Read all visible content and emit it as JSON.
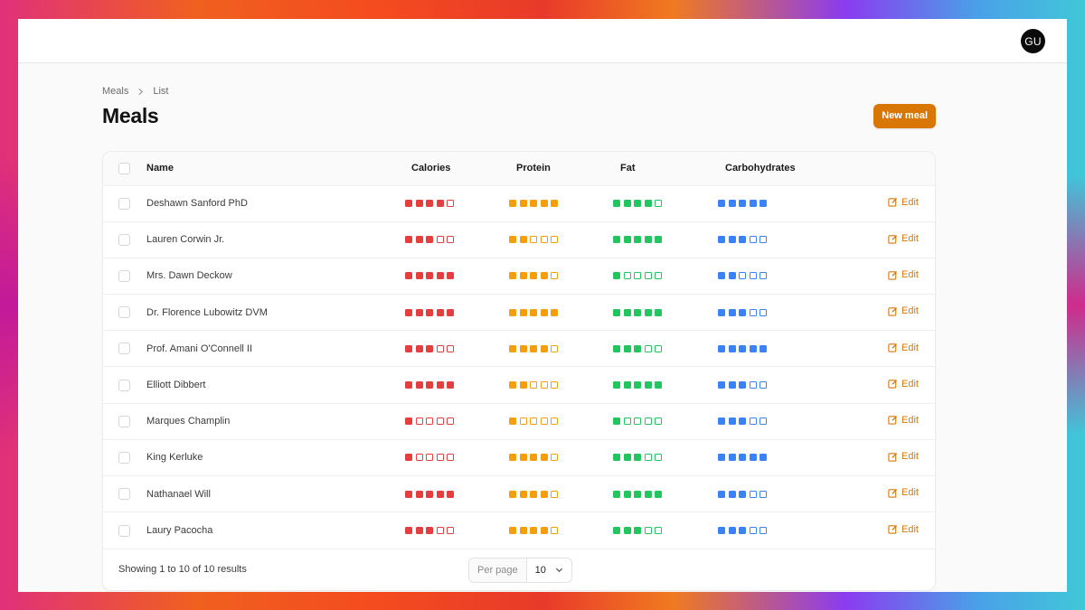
{
  "user": {
    "initials": "GU"
  },
  "breadcrumb": {
    "items": [
      "Meals",
      "List"
    ]
  },
  "page": {
    "title": "Meals",
    "new_button": "New meal"
  },
  "table": {
    "headers": {
      "name": "Name",
      "calories": "Calories",
      "protein": "Protein",
      "fat": "Fat",
      "carbohydrates": "Carbohydrates"
    },
    "scale_max": 5,
    "colors": {
      "calories": "#e53e3e",
      "protein": "#f59e0b",
      "fat": "#22c55e",
      "carbohydrates": "#3b82f6"
    },
    "edit_label": "Edit",
    "rows": [
      {
        "name": "Deshawn Sanford PhD",
        "calories": 4,
        "protein": 5,
        "fat": 4,
        "carbohydrates": 5
      },
      {
        "name": "Lauren Corwin Jr.",
        "calories": 3,
        "protein": 2,
        "fat": 5,
        "carbohydrates": 3
      },
      {
        "name": "Mrs. Dawn Deckow",
        "calories": 5,
        "protein": 4,
        "fat": 1,
        "carbohydrates": 2
      },
      {
        "name": "Dr. Florence Lubowitz DVM",
        "calories": 5,
        "protein": 5,
        "fat": 5,
        "carbohydrates": 3
      },
      {
        "name": "Prof. Amani O'Connell II",
        "calories": 3,
        "protein": 4,
        "fat": 3,
        "carbohydrates": 5
      },
      {
        "name": "Elliott Dibbert",
        "calories": 5,
        "protein": 2,
        "fat": 5,
        "carbohydrates": 3
      },
      {
        "name": "Marques Champlin",
        "calories": 1,
        "protein": 1,
        "fat": 1,
        "carbohydrates": 3
      },
      {
        "name": "King Kerluke",
        "calories": 1,
        "protein": 4,
        "fat": 3,
        "carbohydrates": 5
      },
      {
        "name": "Nathanael Will",
        "calories": 5,
        "protein": 4,
        "fat": 5,
        "carbohydrates": 3
      },
      {
        "name": "Laury Pacocha",
        "calories": 3,
        "protein": 4,
        "fat": 3,
        "carbohydrates": 3
      }
    ]
  },
  "footer": {
    "showing": "Showing 1 to 10 of 10 results",
    "per_page_label": "Per page",
    "per_page_value": "10"
  }
}
